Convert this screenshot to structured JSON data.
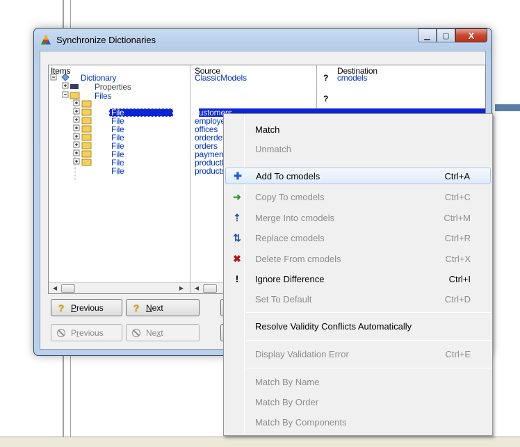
{
  "window": {
    "title": "Synchronize Dictionaries",
    "min_glyph": "▁",
    "max_glyph": "▢",
    "close_glyph": "X"
  },
  "grid": {
    "headers": {
      "items": "Items",
      "source": "Source",
      "destination": "Destination"
    },
    "root": {
      "label": "Dictionary",
      "source": "ClassicModels",
      "dest_q": "?",
      "dest": "cmodels"
    },
    "properties": {
      "label": "Properties"
    },
    "files": {
      "label": "Files",
      "dest_q": "?"
    },
    "file_rows": [
      {
        "label": "File",
        "source": "customers"
      },
      {
        "label": "File",
        "source": "employees"
      },
      {
        "label": "File",
        "source": "offices"
      },
      {
        "label": "File",
        "source": "orderdetails"
      },
      {
        "label": "File",
        "source": "orders"
      },
      {
        "label": "File",
        "source": "payments"
      },
      {
        "label": "File",
        "source": "productlines"
      },
      {
        "label": "File",
        "source": "products"
      }
    ]
  },
  "buttons": {
    "prev_q": {
      "glyph": "?",
      "label": "Previous",
      "accel": "P",
      "rest": "revious"
    },
    "next_q": {
      "glyph": "?",
      "label": "Next",
      "accel": "N",
      "rest": "ext"
    },
    "prev_d": {
      "label": "Previous",
      "pre": "P",
      "accel": "r",
      "rest": "evious"
    },
    "next_d": {
      "label": "Next",
      "pre": "Ne",
      "accel": "x",
      "rest": "t"
    }
  },
  "menu": {
    "items": [
      {
        "label": "Match",
        "key": "",
        "icon": "",
        "disabled": false
      },
      {
        "label": "Unmatch",
        "key": "",
        "icon": "",
        "disabled": true
      },
      {
        "label": "Add To cmodels",
        "key": "Ctrl+A",
        "icon": "✚",
        "disabled": false
      },
      {
        "label": "Copy To cmodels",
        "key": "Ctrl+C",
        "icon": "➜",
        "disabled": true
      },
      {
        "label": "Merge Into cmodels",
        "key": "Ctrl+M",
        "icon": "⇡",
        "disabled": true
      },
      {
        "label": "Replace cmodels",
        "key": "Ctrl+R",
        "icon": "⇅",
        "disabled": true
      },
      {
        "label": "Delete From cmodels",
        "key": "Ctrl+X",
        "icon": "✖",
        "disabled": true
      },
      {
        "label": "Ignore Difference",
        "key": "Ctrl+I",
        "icon": "!",
        "disabled": false
      },
      {
        "label": "Set To Default",
        "key": "Ctrl+D",
        "icon": "",
        "disabled": true
      },
      {
        "label": "Resolve Validity Conflicts Automatically",
        "key": "",
        "icon": "",
        "disabled": false
      },
      {
        "label": "Display Validation Error",
        "key": "Ctrl+E",
        "icon": "",
        "disabled": true
      },
      {
        "label": "Match By Name",
        "key": "",
        "icon": "",
        "disabled": true
      },
      {
        "label": "Match By Order",
        "key": "",
        "icon": "",
        "disabled": true
      },
      {
        "label": "Match By Components",
        "key": "",
        "icon": "",
        "disabled": true
      }
    ]
  },
  "colors": {
    "link_blue": "#0033cc",
    "selection": "#0a24d8",
    "add_icon": "#1f5fd0",
    "copy_icon": "#2e9a2e",
    "delete_icon": "#b01818",
    "merge_icon": "#2050c0"
  }
}
